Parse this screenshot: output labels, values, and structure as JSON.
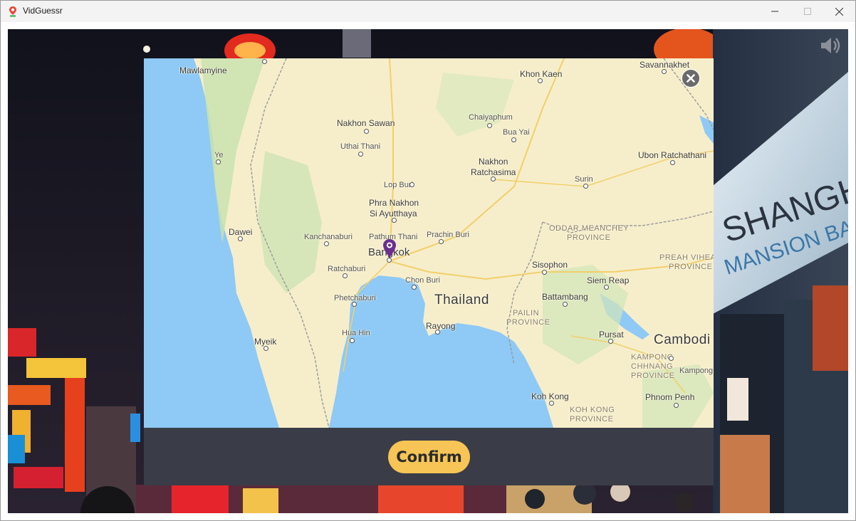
{
  "window": {
    "title": "VidGuessr",
    "app_icon": "map-pin-icon",
    "controls": [
      "minimize-icon",
      "maximize-icon",
      "close-icon"
    ]
  },
  "video": {
    "volume_icon": "volume-icon"
  },
  "map": {
    "close_icon": "close-circle-icon",
    "marker_icon": "map-marker-icon",
    "marker_color": "#6b2f8f",
    "labels": {
      "mawlamyine": "Mawlamyine",
      "khon_kaen": "Khon Kaen",
      "savannakhet": "Savannakhet",
      "nakhon_sawan": "Nakhon Sawan",
      "chaiyaphum": "Chaiyaphum",
      "bua_yai": "Bua Yai",
      "uthai_thani": "Uthai Thani",
      "ye": "Ye",
      "nakhon_ratchasima_1": "Nakhon",
      "nakhon_ratchasima_2": "Ratchasima",
      "ubon_ratchathani": "Ubon Ratchathani",
      "lop_buri": "Lop Buri",
      "surin": "Surin",
      "phra_nakhon_1": "Phra Nakhon",
      "phra_nakhon_2": "Si Ayutthaya",
      "dawei": "Dawei",
      "kanchanaburi": "Kanchanaburi",
      "pathum_thani": "Pathum Thani",
      "prachin_buri": "Prachin Buri",
      "oddar_meanchey_1": "ODDAR MEANCHEY",
      "oddar_meanchey_2": "PROVINCE",
      "bangkok": "Bangkok",
      "preah_vihear_1": "PREAH VIHEA",
      "preah_vihear_2": "PROVINCE",
      "ratchaburi": "Ratchaburi",
      "sisophon": "Sisophon",
      "siem_reap": "Siem Reap",
      "chon_buri": "Chon Buri",
      "thailand": "Thailand",
      "battambang": "Battambang",
      "phetchaburi": "Phetchaburi",
      "pailin_1": "PAILIN",
      "pailin_2": "PROVINCE",
      "rayong": "Rayong",
      "hua_hin": "Hua Hin",
      "pursat": "Pursat",
      "cambodia": "Cambodi",
      "myeik": "Myeik",
      "kampong_chhnang_1": "KAMPONG",
      "kampong_chhnang_2": "CHHNANG",
      "kampong_chhnang_3": "PROVINCE",
      "kampong": "Kampong",
      "koh_kong": "Koh Kong",
      "phnom_penh": "Phnom Penh",
      "koh_kong_prov_1": "KOH KONG",
      "koh_kong_prov_2": "PROVINCE"
    }
  },
  "confirm_label": "Confirm"
}
